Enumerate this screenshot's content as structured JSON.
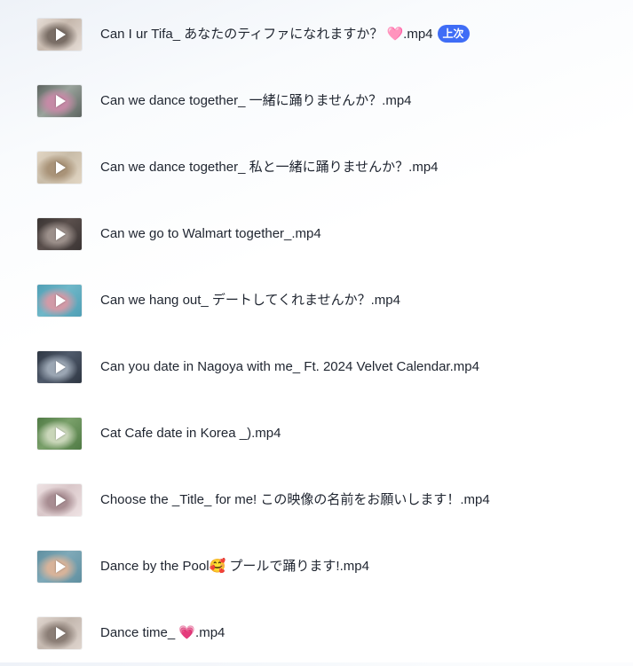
{
  "files": [
    {
      "name": "Can I ur Tifa_ あなたのティファになれますか？ 🩷.mp4",
      "badge": "上次",
      "thumb": [
        "#c6b8ad",
        "#7a6e66",
        "#e6ddd6"
      ]
    },
    {
      "name": "Can we dance together_ 一緒に踊りませんか？.mp4",
      "thumb": [
        "#9aa39c",
        "#c58aa6",
        "#5d6460"
      ]
    },
    {
      "name": "Can we dance together_ 私と一緒に踊りませんか？.mp4",
      "thumb": [
        "#c8bca8",
        "#a99378",
        "#e2d6c4"
      ]
    },
    {
      "name": "Can we go to Walmart together_.mp4",
      "thumb": [
        "#5a4f4c",
        "#9b8f8a",
        "#3a3433"
      ]
    },
    {
      "name": "Can we hang out_ デートしてくれませんか？.mp4",
      "thumb": [
        "#6fb7c8",
        "#d19aa7",
        "#4f9fb5"
      ]
    },
    {
      "name": "Can you date in Nagoya with me_ Ft. 2024 Velvet Calendar.mp4",
      "thumb": [
        "#4f5a6b",
        "#9ba6b3",
        "#2e3642"
      ]
    },
    {
      "name": "Cat Cafe date in Korea _).mp4",
      "thumb": [
        "#7aa06a",
        "#c9d6b9",
        "#4f7a44"
      ]
    },
    {
      "name": "Choose the _Title_ for me! この映像の名前をお願いします！.mp4",
      "thumb": [
        "#d9c7c9",
        "#a88d92",
        "#efe3e4"
      ]
    },
    {
      "name": "Dance by the Pool🥰 プールで踊ります!.mp4",
      "thumb": [
        "#7fa9b8",
        "#d7b39a",
        "#5f8fa0"
      ]
    },
    {
      "name": "Dance time_ 💗.mp4",
      "thumb": [
        "#c3b7ae",
        "#8b7e76",
        "#e0d6cf"
      ]
    }
  ]
}
